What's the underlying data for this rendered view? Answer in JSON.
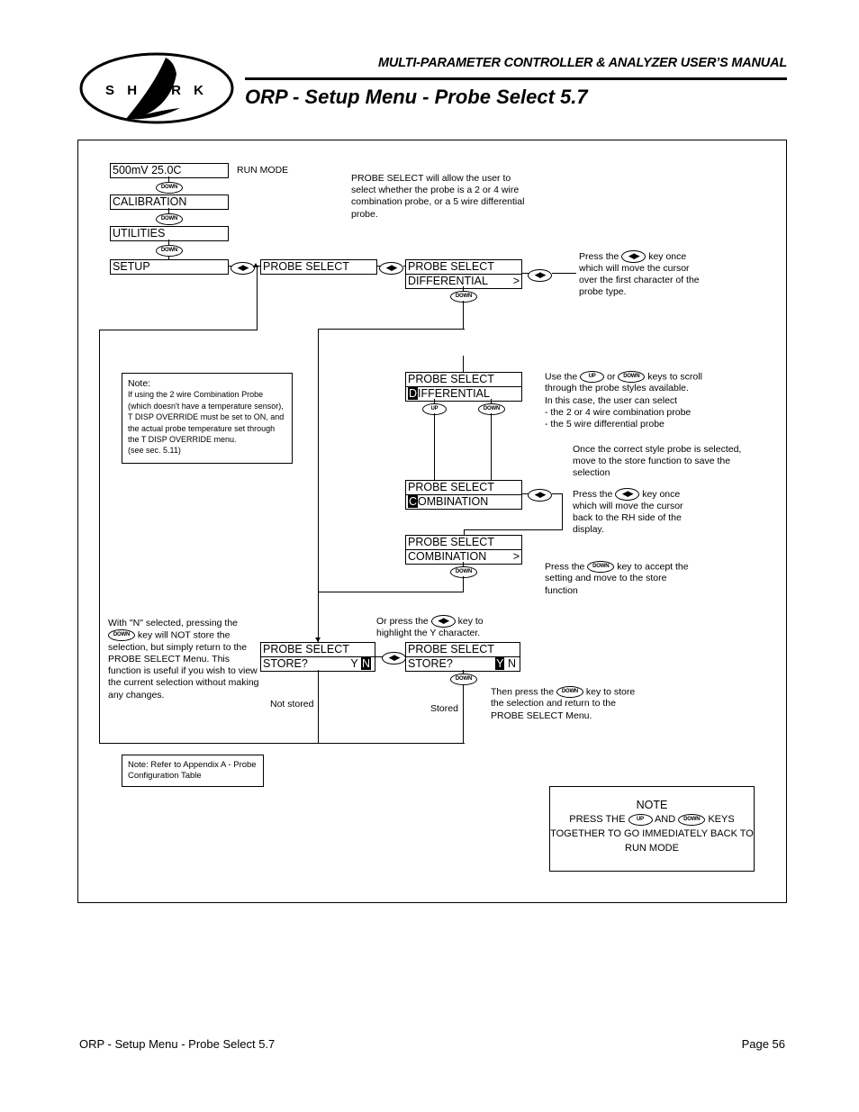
{
  "header": {
    "manual_title": "MULTI-PARAMETER CONTROLLER & ANALYZER USER’S MANUAL",
    "page_title": "ORP - Setup Menu - Probe Select 5.7",
    "logo_letters": "S H A R K"
  },
  "keys": {
    "down": "DOWN",
    "up": "UP",
    "left_right": "◀▶"
  },
  "menu_chain": {
    "run_display": "500mV  25.0C",
    "run_label": "RUN MODE",
    "items": [
      "CALIBRATION",
      "UTILITIES",
      "SETUP"
    ]
  },
  "displays": {
    "probe_select_menu": "PROBE SELECT",
    "title": "PROBE SELECT",
    "differential": "DIFFERENTIAL",
    "combination": "COMBINATION",
    "store": "STORE?",
    "cursor": ">",
    "yes": "Y",
    "no": "N",
    "diff_first_char": "D",
    "diff_rest": "IFFERENTIAL",
    "comb_first_char": "C",
    "comb_rest": "OMBINATION"
  },
  "callouts": {
    "description": "PROBE SELECT will allow the user to select whether the probe is a 2 or 4 wire combination probe, or a 5 wire differential probe.",
    "press_lr_first": {
      "pre": "Press the",
      "post": "key once which will move the cursor over the first character of the probe type."
    },
    "scroll": {
      "pre": "Use the",
      "mid": "or",
      "post": "keys to scroll through the probe styles available.",
      "line2": "In this case, the user can select",
      "bullet1": "- the 2 or 4 wire combination probe",
      "bullet2": "- the 5 wire differential probe"
    },
    "once_selected": "Once the correct style probe is selected, move to the store function to save the selection",
    "press_lr_back": {
      "pre": "Press the",
      "post": "key once which will move the cursor back to the RH side of the display."
    },
    "press_down_accept": {
      "pre": "Press the",
      "post": "key to accept the setting and move to the store function"
    },
    "or_press_lr": {
      "pre": "Or press the",
      "post": "key to highlight the Y character."
    },
    "then_press_down": {
      "pre": "Then press the",
      "post": "key to store the selection and return to the PROBE SELECT Menu."
    },
    "with_n_selected": {
      "pre": "With \"N\" selected, pressing the",
      "post": "key will NOT store the selection, but simply return to the PROBE SELECT Menu. This function is useful if you wish to view the current selection without making any changes."
    },
    "not_stored": "Not stored",
    "stored": "Stored"
  },
  "note_box": {
    "title": "Note:",
    "body": "If using the 2 wire Combination Probe (which doesn't have a temperature sensor), T DISP OVERRIDE must be set to ON, and the actual probe temperature set through the T DISP OVERRIDE menu.",
    "reference": "(see sec. 5.11)"
  },
  "appendix_note": "Note: Refer to Appendix A - Probe Configuration Table",
  "big_note": {
    "title": "NOTE",
    "l1_pre": "PRESS THE",
    "l1_mid": "AND",
    "l1_post": "KEYS",
    "l2": "TOGETHER TO GO IMMEDIATELY BACK TO",
    "l3": "RUN MODE"
  },
  "footer": {
    "left": "ORP - Setup Menu - Probe Select 5.7",
    "right": "Page 56"
  }
}
